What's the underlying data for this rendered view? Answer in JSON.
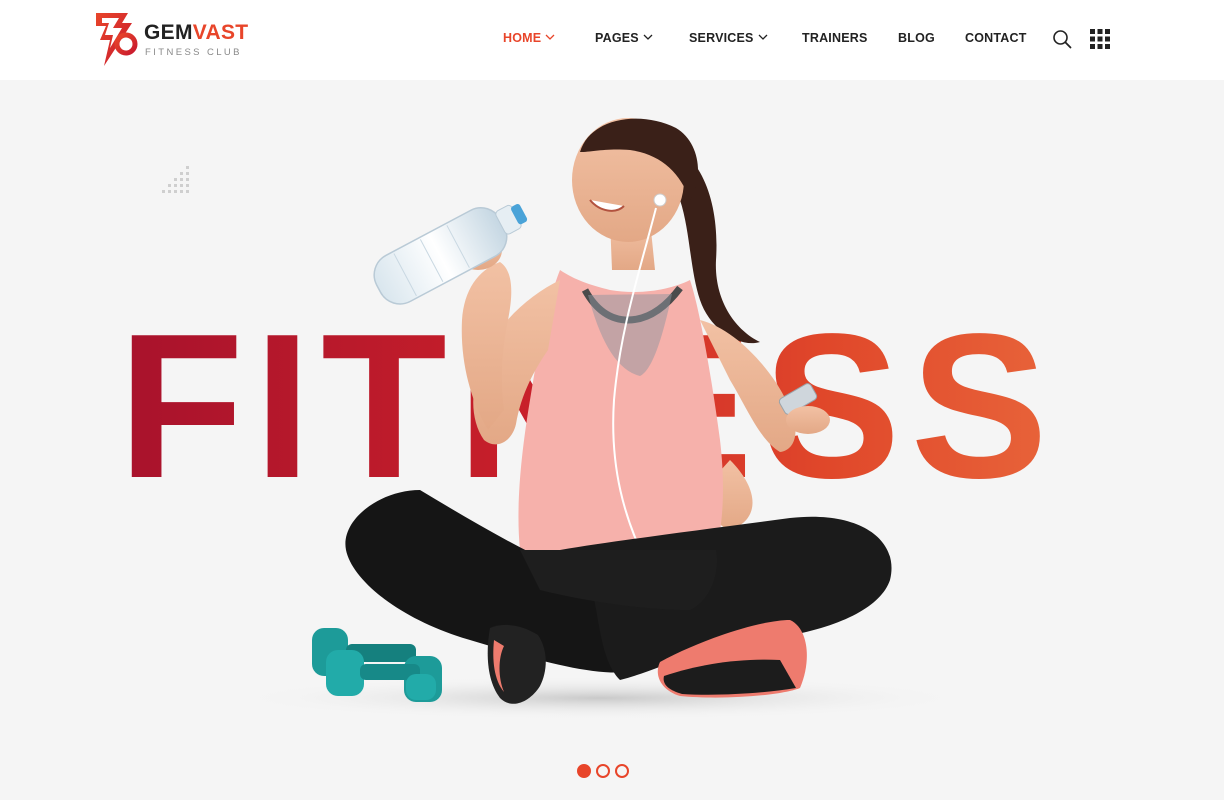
{
  "brand": {
    "name_part1": "GEM",
    "name_part2": "VAST",
    "tagline": "FITNESS CLUB",
    "accent_color": "#e8452a"
  },
  "nav": {
    "items": [
      {
        "label": "HOME",
        "active": true,
        "has_dropdown": true
      },
      {
        "label": "PAGES",
        "active": false,
        "has_dropdown": true
      },
      {
        "label": "SERVICES",
        "active": false,
        "has_dropdown": true
      },
      {
        "label": "TRAINERS",
        "active": false,
        "has_dropdown": false
      },
      {
        "label": "BLOG",
        "active": false,
        "has_dropdown": false
      },
      {
        "label": "CONTACT",
        "active": false,
        "has_dropdown": false
      }
    ],
    "icons": [
      "search-icon",
      "grid-menu-icon"
    ]
  },
  "hero": {
    "headline": "FITNESS",
    "slider": {
      "total": 3,
      "current": 1
    }
  }
}
